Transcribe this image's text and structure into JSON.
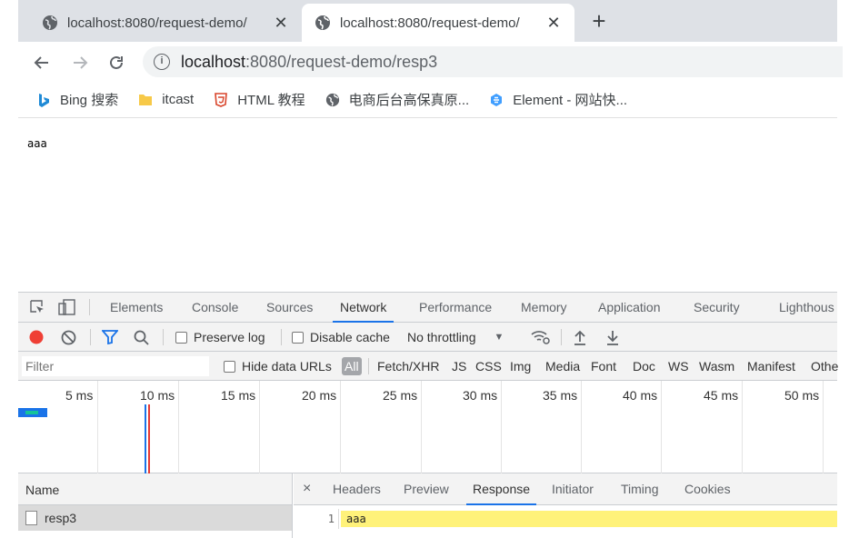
{
  "browser": {
    "tabs": [
      {
        "title": "localhost:8080/request-demo/",
        "active": false
      },
      {
        "title": "localhost:8080/request-demo/",
        "active": true
      }
    ],
    "new_tab": "+",
    "close_glyph": "✕",
    "url_host": "localhost",
    "url_rest": ":8080/request-demo/resp3",
    "bookmarks": [
      {
        "label": "Bing 搜索",
        "icon": "bing-icon"
      },
      {
        "label": "itcast",
        "icon": "folder-icon"
      },
      {
        "label": "HTML 教程",
        "icon": "html5-icon"
      },
      {
        "label": "电商后台高保真原...",
        "icon": "globe-icon"
      },
      {
        "label": "Element - 网站快...",
        "icon": "element-icon"
      }
    ]
  },
  "page": {
    "body_text": "aaa"
  },
  "devtools": {
    "tabs": [
      "Elements",
      "Console",
      "Sources",
      "Network",
      "Performance",
      "Memory",
      "Application",
      "Security",
      "Lighthous"
    ],
    "active_tab": "Network",
    "toolbar": {
      "preserve_log": "Preserve log",
      "disable_cache": "Disable cache",
      "throttling": "No throttling"
    },
    "filter": {
      "placeholder": "Filter",
      "hide_data_urls": "Hide data URLs",
      "types": [
        "All",
        "Fetch/XHR",
        "JS",
        "CSS",
        "Img",
        "Media",
        "Font",
        "Doc",
        "WS",
        "Wasm",
        "Manifest",
        "Othe"
      ]
    },
    "timeline_ticks": [
      "5 ms",
      "10 ms",
      "15 ms",
      "20 ms",
      "25 ms",
      "30 ms",
      "35 ms",
      "40 ms",
      "45 ms",
      "50 ms"
    ],
    "requests": {
      "name_header": "Name",
      "rows": [
        {
          "name": "resp3"
        }
      ]
    },
    "detail": {
      "close": "×",
      "tabs": [
        "Headers",
        "Preview",
        "Response",
        "Initiator",
        "Timing",
        "Cookies"
      ],
      "active_tab": "Response",
      "response_lines": [
        {
          "no": "1",
          "text": "aaa"
        }
      ]
    }
  }
}
